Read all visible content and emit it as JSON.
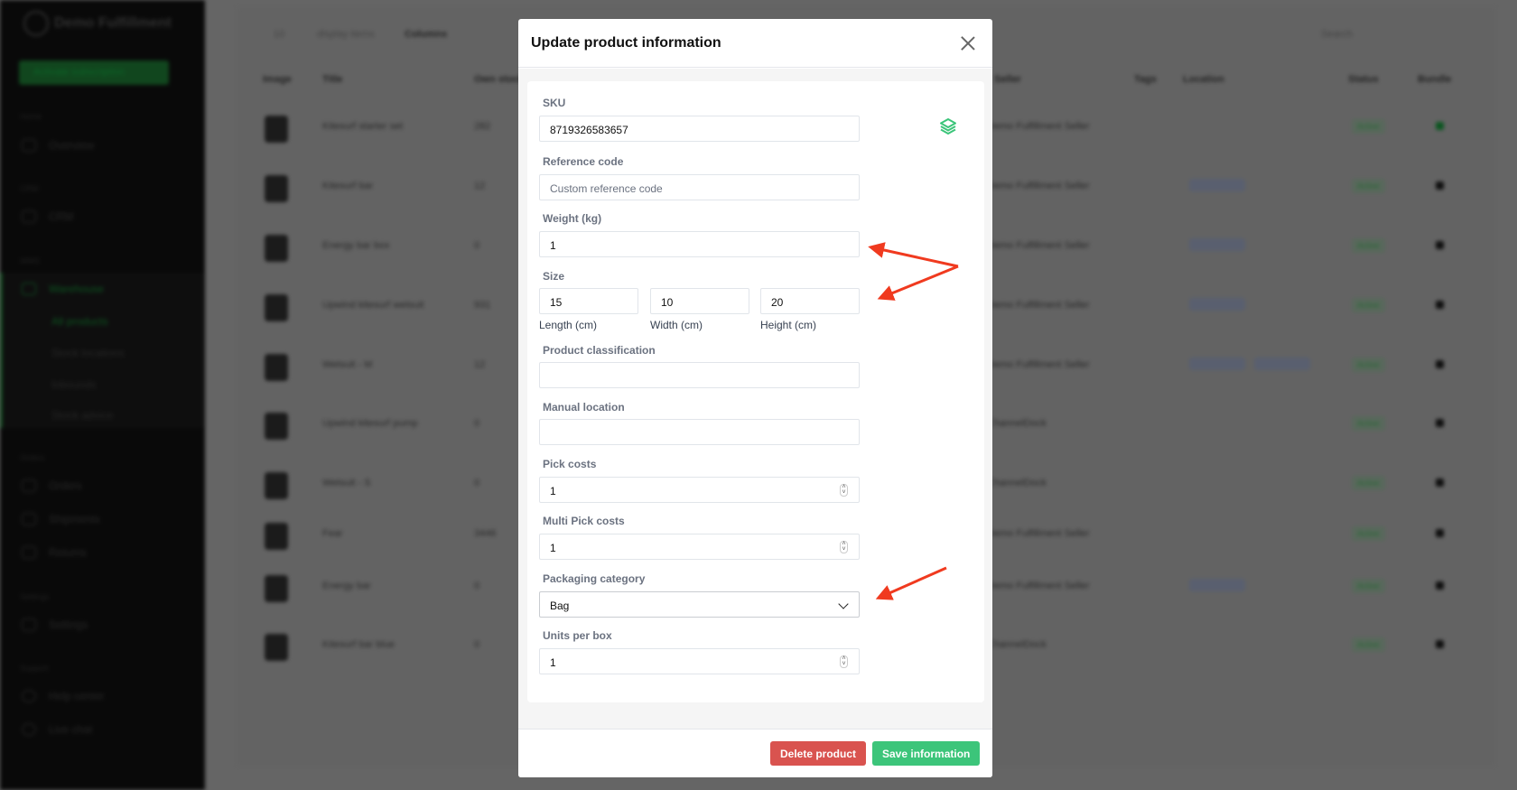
{
  "sidebar": {
    "brand": "Demo Fulfillment",
    "activate": "Activate subscription",
    "sections": {
      "home": "Home",
      "crm": "CRM",
      "wms": "WMS",
      "orders": "Orders",
      "settings": "Settings",
      "support": "Support"
    },
    "items": {
      "overview": "Overview",
      "crm": "CRM",
      "warehouse": "Warehouse",
      "all_products": "All products",
      "stock_locations": "Stock locations",
      "inbounds": "Inbounds",
      "stock_advice": "Stock advice",
      "orders": "Orders",
      "shipments": "Shipments",
      "returns": "Returns",
      "settings": "Settings",
      "help": "Help center",
      "chat": "Live chat"
    }
  },
  "toolbar": {
    "per_page": "10",
    "display_items": "display items",
    "columns": "Columns",
    "search_placeholder": "Search"
  },
  "table": {
    "headers": {
      "image": "Image",
      "title": "Title",
      "own_stock": "Own stock",
      "seller": "Seller",
      "tags": "Tags",
      "location": "Location",
      "status": "Status",
      "bundle": "Bundle"
    },
    "rows": [
      {
        "title": "Kitesurf starter set",
        "stock": "282",
        "seller": "Demo Fulfillment Seller",
        "status": "Active"
      },
      {
        "title": "Kitesurf bar",
        "stock": "12",
        "seller": "Demo Fulfillment Seller",
        "status": "Active"
      },
      {
        "title": "Energy bar box",
        "stock": "0",
        "seller": "Demo Fulfillment Seller",
        "status": "Active"
      },
      {
        "title": "Upwind kitesurf wetsuit",
        "stock": "931",
        "seller": "Demo Fulfillment Seller",
        "status": "Active"
      },
      {
        "title": "Wetsuit - M",
        "stock": "12",
        "seller": "Demo Fulfillment Seller",
        "status": "Active"
      },
      {
        "title": "Upwind kitesurf pump",
        "stock": "0",
        "seller": "ChannelDock",
        "status": "Active"
      },
      {
        "title": "Wetsuit - S",
        "stock": "0",
        "seller": "ChannelDock",
        "status": "Active"
      },
      {
        "title": "Fear",
        "stock": "3446",
        "seller": "Demo Fulfillment Seller",
        "status": "Active"
      },
      {
        "title": "Energy bar",
        "stock": "0",
        "seller": "Demo Fulfillment Seller",
        "status": "Active"
      },
      {
        "title": "Kitesurf bar blue",
        "stock": "0",
        "seller": "ChannelDock",
        "status": "Active"
      }
    ]
  },
  "modal": {
    "title": "Update product information",
    "sku": {
      "label": "SKU",
      "value": "8719326583657"
    },
    "reference": {
      "label": "Reference code",
      "placeholder": "Custom reference code"
    },
    "weight": {
      "label": "Weight (kg)",
      "value": "1"
    },
    "size": {
      "label": "Size",
      "length": "15",
      "width": "10",
      "height": "20",
      "length_label": "Length (cm)",
      "width_label": "Width (cm)",
      "height_label": "Height (cm)"
    },
    "classification": {
      "label": "Product classification",
      "value": ""
    },
    "manual_location": {
      "label": "Manual location",
      "value": ""
    },
    "pick_costs": {
      "label": "Pick costs",
      "value": "1"
    },
    "multi_pick_costs": {
      "label": "Multi Pick costs",
      "value": "1"
    },
    "packaging": {
      "label": "Packaging category",
      "value": "Bag"
    },
    "units_per_box": {
      "label": "Units per box",
      "value": "1"
    },
    "delete": "Delete product",
    "save": "Save information"
  },
  "colors": {
    "accent": "#3cc57a",
    "danger": "#d9534f",
    "annotation": "#f03a1f"
  }
}
